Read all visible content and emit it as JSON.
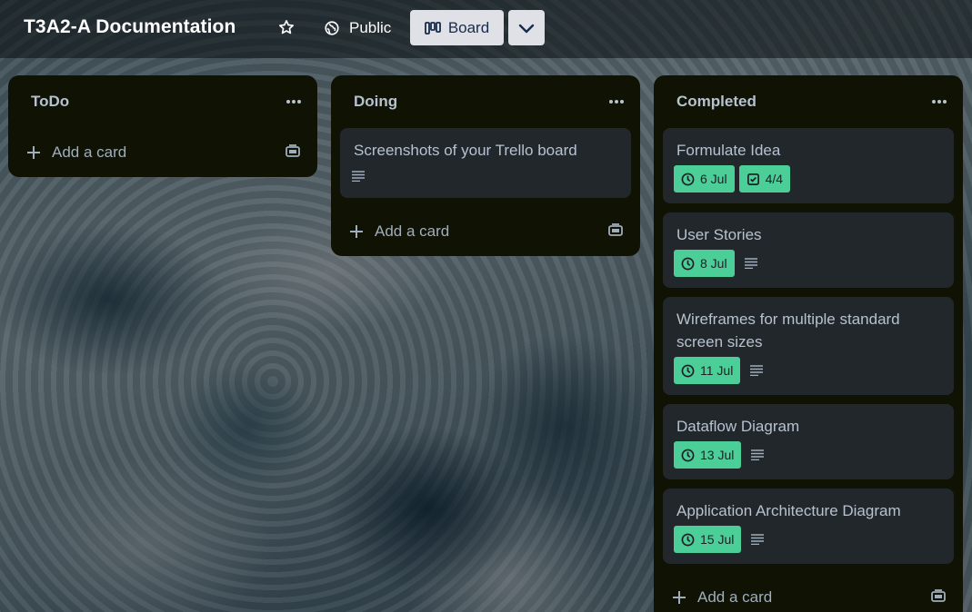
{
  "header": {
    "board_title": "T3A2-A Documentation",
    "visibility_label": "Public",
    "view_label": "Board"
  },
  "lists": [
    {
      "title": "ToDo",
      "add_card_label": "Add a card",
      "cards": []
    },
    {
      "title": "Doing",
      "add_card_label": "Add a card",
      "cards": [
        {
          "title": "Screenshots of your Trello board",
          "has_description": true
        }
      ]
    },
    {
      "title": "Completed",
      "add_card_label": "Add a card",
      "cards": [
        {
          "title": "Formulate Idea",
          "due": "6 Jul",
          "checklist": "4/4",
          "has_description": false
        },
        {
          "title": "User Stories",
          "due": "8 Jul",
          "has_description": true
        },
        {
          "title": "Wireframes for multiple standard screen sizes",
          "due": "11 Jul",
          "has_description": true
        },
        {
          "title": "Dataflow Diagram",
          "due": "13 Jul",
          "has_description": true
        },
        {
          "title": "Application Architecture Diagram",
          "due": "15 Jul",
          "has_description": true
        }
      ]
    }
  ],
  "icons": {
    "star": "star-icon",
    "visibility": "globe-icon",
    "board_view": "board-icon",
    "dropdown": "chevron-down-icon",
    "list_menu": "more-dots-icon",
    "add": "plus-icon",
    "template": "card-template-icon",
    "due": "clock-icon",
    "checklist": "checkbox-icon",
    "description": "description-icon"
  },
  "colors": {
    "list_bg": "#101204",
    "card_bg": "#22272b",
    "badge_complete": "#4bce97",
    "text": "#b6c2cf",
    "board_button_bg": "#dfe1e6"
  }
}
